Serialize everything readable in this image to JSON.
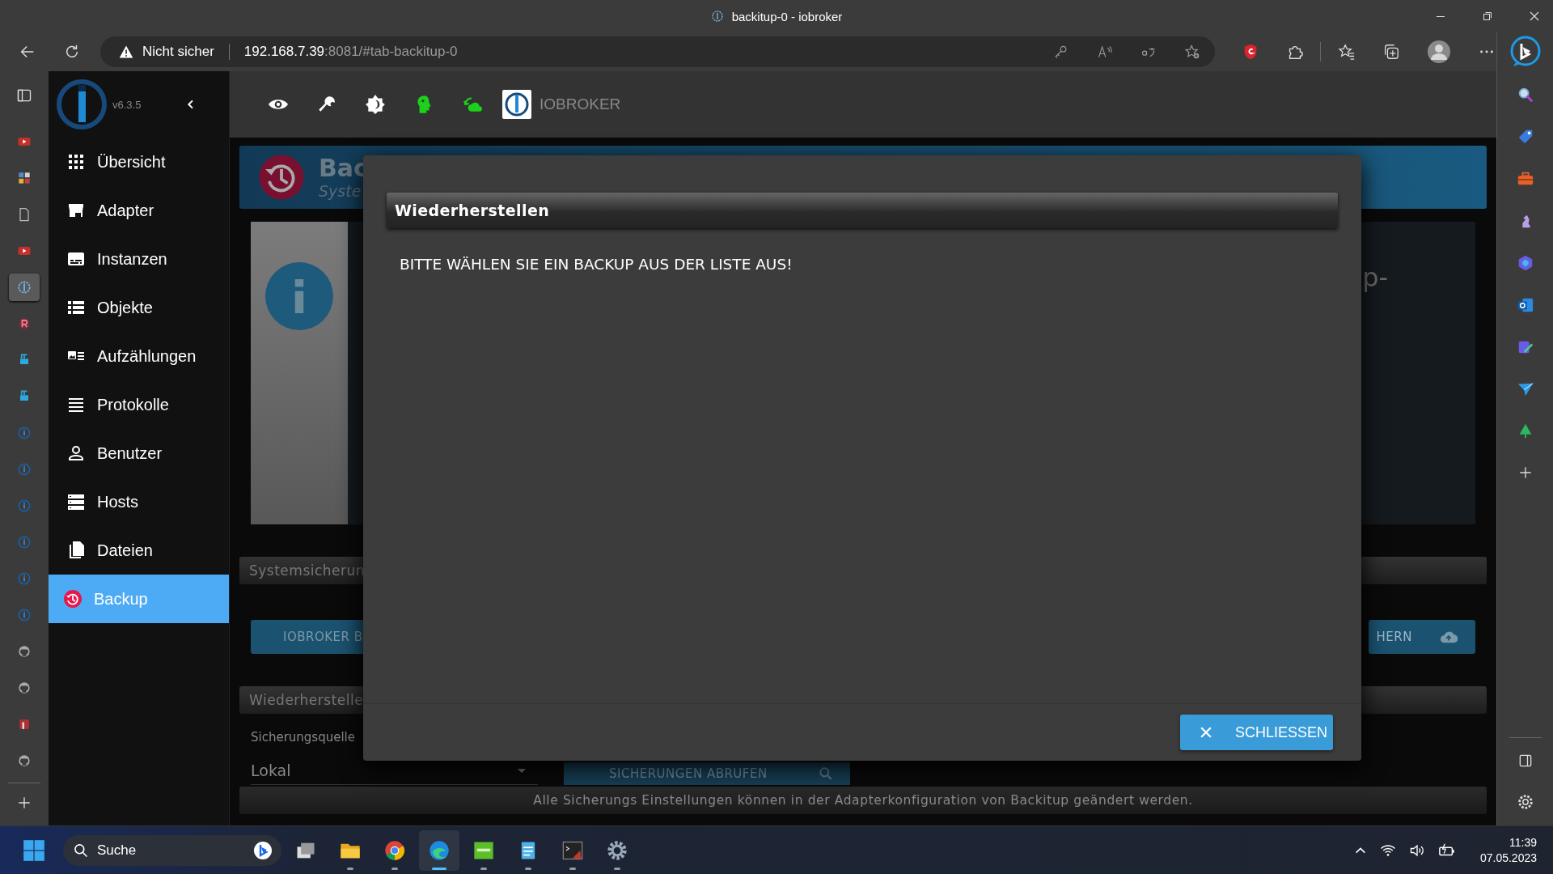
{
  "browser": {
    "title": "backitup-0 - iobroker",
    "security": "Nicht sicher",
    "url_host": "192.168.7.39",
    "url_rest": ":8081/#tab-backitup-0"
  },
  "vertical_tabs": [
    {
      "kind": "video",
      "selected": false
    },
    {
      "kind": "mosaic",
      "selected": false
    },
    {
      "kind": "document",
      "selected": false
    },
    {
      "kind": "video",
      "selected": false
    },
    {
      "kind": "iobroker",
      "selected": true
    },
    {
      "kind": "r-circle",
      "selected": false
    },
    {
      "kind": "crane",
      "selected": false
    },
    {
      "kind": "crane",
      "selected": false
    },
    {
      "kind": "info",
      "selected": false
    },
    {
      "kind": "info",
      "selected": false
    },
    {
      "kind": "info",
      "selected": false
    },
    {
      "kind": "info",
      "selected": false
    },
    {
      "kind": "info",
      "selected": false
    },
    {
      "kind": "info",
      "selected": false
    },
    {
      "kind": "github",
      "selected": false
    },
    {
      "kind": "github",
      "selected": false
    },
    {
      "kind": "red-square",
      "selected": false
    },
    {
      "kind": "github",
      "selected": false
    }
  ],
  "app": {
    "version": "v6.3.5",
    "brand": "IOBROKER",
    "nav": [
      {
        "label": "Übersicht",
        "kind": "grid",
        "selected": false
      },
      {
        "label": "Adapter",
        "kind": "store",
        "selected": false
      },
      {
        "label": "Instanzen",
        "kind": "subtitles",
        "selected": false
      },
      {
        "label": "Objekte",
        "kind": "list",
        "selected": false
      },
      {
        "label": "Aufzählungen",
        "kind": "card-list",
        "selected": false
      },
      {
        "label": "Protokolle",
        "kind": "lines",
        "selected": false
      },
      {
        "label": "Benutzer",
        "kind": "person",
        "selected": false
      },
      {
        "label": "Hosts",
        "kind": "storage",
        "selected": false
      },
      {
        "label": "Dateien",
        "kind": "files",
        "selected": false
      },
      {
        "label": "Backup",
        "kind": "backup",
        "selected": true
      }
    ]
  },
  "page": {
    "title": "Bac",
    "subtitle": "Syste",
    "card_text": "p-",
    "system_backup": {
      "title": "Systemsicherun",
      "left_button": "IOBROKER B",
      "right_button": "HERN"
    },
    "restore": {
      "title": "Wiederherstelle",
      "source_label": "Sicherungsquelle",
      "source_value": "Lokal",
      "fetch_button": "SICHERUNGEN ABRUFEN"
    },
    "footer": "Alle Sicherungs Einstellungen können in der Adapterkonfiguration von Backitup geändert werden."
  },
  "dialog": {
    "title": "Wiederherstellen",
    "message": "BITTE WÄHLEN SIE EIN BACKUP AUS DER LISTE AUS!",
    "close_button": "SCHLIESSEN"
  },
  "taskbar": {
    "search_placeholder": "Suche",
    "apps": [
      {
        "kind": "taskview",
        "running": false,
        "selected": false
      },
      {
        "kind": "folder",
        "running": true,
        "selected": false
      },
      {
        "kind": "chrome",
        "running": true,
        "selected": false
      },
      {
        "kind": "edge",
        "running": true,
        "selected": true
      },
      {
        "kind": "green-app",
        "running": true,
        "selected": false
      },
      {
        "kind": "notepad",
        "running": true,
        "selected": false
      },
      {
        "kind": "terminal",
        "running": true,
        "selected": false
      },
      {
        "kind": "settings",
        "running": true,
        "selected": false
      }
    ],
    "time": "11:39",
    "date": "07.05.2023"
  }
}
